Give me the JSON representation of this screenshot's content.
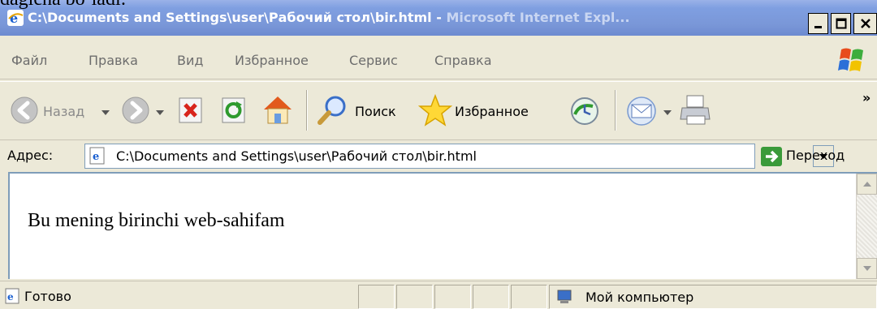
{
  "window": {
    "title_main": "C:\\Documents and Settings\\user\\Рабочий стол\\bir.html - ",
    "title_app": "Microsoft Internet Expl...",
    "doc_text_top": "dagicha bo`ladi:"
  },
  "menu": {
    "items": [
      "Файл",
      "Правка",
      "Вид",
      "Избранное",
      "Сервис",
      "Справка"
    ]
  },
  "toolbar": {
    "back_label": "Назад",
    "search_label": "Поиск",
    "favorites_label": "Избранное",
    "chevron": "»"
  },
  "address": {
    "label": "Адрес:",
    "value": "C:\\Documents and Settings\\user\\Рабочий стол\\bir.html",
    "go_label": "Переход"
  },
  "content": {
    "text": "Bu mening birinchi web-sahifam"
  },
  "status": {
    "text": "Готово",
    "zone": "Мой компьютер"
  },
  "colors": {
    "titlebar": "#7a97d8",
    "chrome": "#ece9d8",
    "menu_text": "#6d6d6d",
    "go_green": "#3a9a3a"
  },
  "icons": {
    "title": "ie-icon",
    "back": "back-arrow-icon",
    "forward": "forward-arrow-icon",
    "stop": "stop-icon",
    "refresh": "refresh-icon",
    "home": "home-icon",
    "search": "search-icon",
    "favorites": "favorites-star-icon",
    "history": "history-icon",
    "mail": "mail-icon",
    "print": "print-icon"
  }
}
